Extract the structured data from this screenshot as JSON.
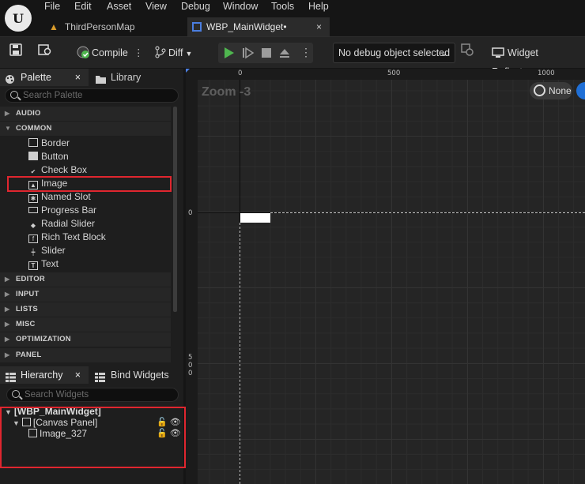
{
  "menu": [
    "File",
    "Edit",
    "Asset",
    "View",
    "Debug",
    "Window",
    "Tools",
    "Help"
  ],
  "tabs": {
    "map": "ThirdPersonMap",
    "widget": "WBP_MainWidget•",
    "close": "×"
  },
  "toolbar": {
    "compile": "Compile",
    "diff": "Diff",
    "debug_select": "No debug object selected",
    "reflector": "Widget Reflector"
  },
  "palette": {
    "tab_label": "Palette",
    "library_label": "Library",
    "close": "×",
    "search_placeholder": "Search Palette",
    "categories_top": [
      "AUDIO",
      "COMMON"
    ],
    "common_items": [
      "Border",
      "Button",
      "Check Box",
      "Image",
      "Named Slot",
      "Progress Bar",
      "Radial Slider",
      "Rich Text Block",
      "Slider",
      "Text"
    ],
    "categories_bottom": [
      "EDITOR",
      "INPUT",
      "LISTS",
      "MISC",
      "OPTIMIZATION",
      "PANEL"
    ]
  },
  "hierarchy": {
    "tab_label": "Hierarchy",
    "close": "×",
    "bind_label": "Bind Widgets",
    "search_placeholder": "Search Widgets",
    "rows": [
      "[WBP_MainWidget]",
      "[Canvas Panel]",
      "Image_327"
    ]
  },
  "canvas": {
    "zoom": "Zoom -3",
    "ruler_top": [
      "0",
      "500",
      "1000"
    ],
    "ruler_left": [
      "0",
      "5",
      "0",
      "0"
    ],
    "dpi_button": "None"
  },
  "colors": {
    "highlight": "#e0262f",
    "accent": "#4b7ee0",
    "play": "#4fb64f"
  }
}
